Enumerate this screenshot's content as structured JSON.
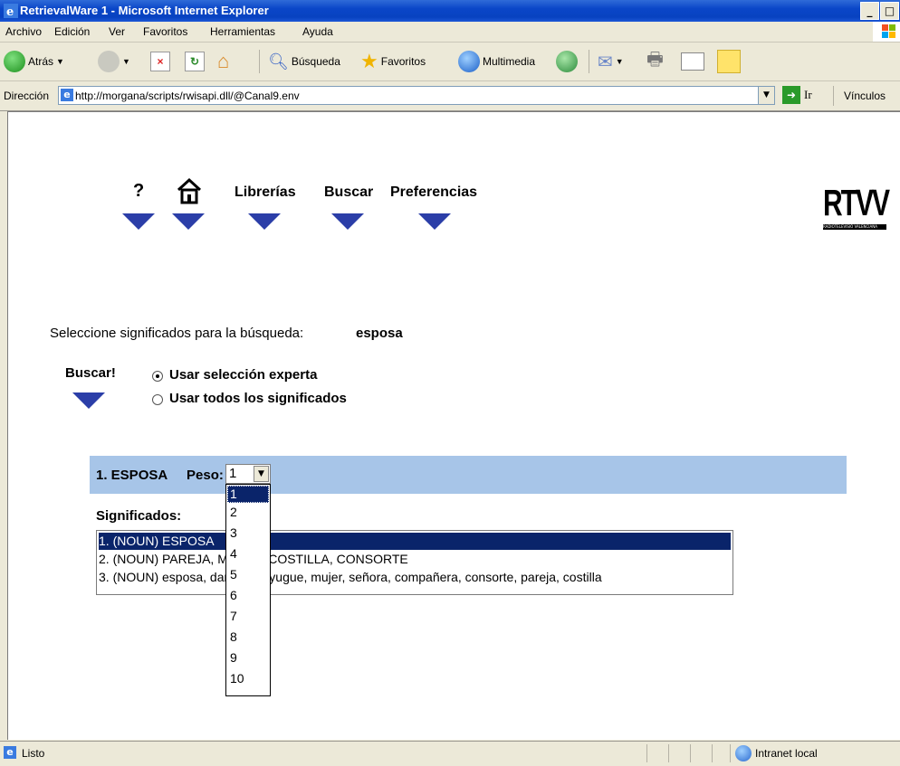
{
  "window": {
    "title": "RetrievalWare 1 - Microsoft Internet Explorer"
  },
  "menu": [
    "Archivo",
    "Edición",
    "Ver",
    "Favoritos",
    "Herramientas",
    "Ayuda"
  ],
  "toolbar": {
    "back": "Atrás",
    "search": "Búsqueda",
    "favorites": "Favoritos",
    "media": "Multimedia"
  },
  "address": {
    "label": "Dirección",
    "url": "http://morgana/scripts/rwisapi.dll/@Canal9.env",
    "go": "Ir",
    "links": "Vínculos"
  },
  "nav": {
    "help": "?",
    "libraries": "Librerías",
    "search": "Buscar",
    "preferences": "Preferencias",
    "logo": "RTVV",
    "logo_sub": "RADIOTELEVISIÓ VALENCIANA"
  },
  "content": {
    "prompt": "Seleccione significados para la búsqueda:",
    "query": "esposa",
    "buscar": "Buscar!",
    "radio_expert": "Usar selección experta",
    "radio_all": "Usar todos los significados",
    "term": "1. ESPOSA",
    "peso_label": "Peso:",
    "peso_value": "1",
    "meanings_label": "Significados:",
    "meanings": [
      "1. (NOUN) ESPOSA",
      "2. (NOUN) PAREJA, MUJER, COSTILLA, CONSORTE",
      "3. (NOUN) esposa, dama, cónyugue, mujer, señora, compañera, consorte, pareja, costilla"
    ],
    "peso_options": [
      "1",
      "2",
      "3",
      "4",
      "5",
      "6",
      "7",
      "8",
      "9",
      "10"
    ]
  },
  "status": {
    "text": "Listo",
    "zone": "Intranet local"
  },
  "colors": {
    "titlebar": "#0a46c8",
    "accent_blue": "#2b3ea8",
    "term_bar": "#a7c5e8",
    "selection": "#0a246a"
  }
}
